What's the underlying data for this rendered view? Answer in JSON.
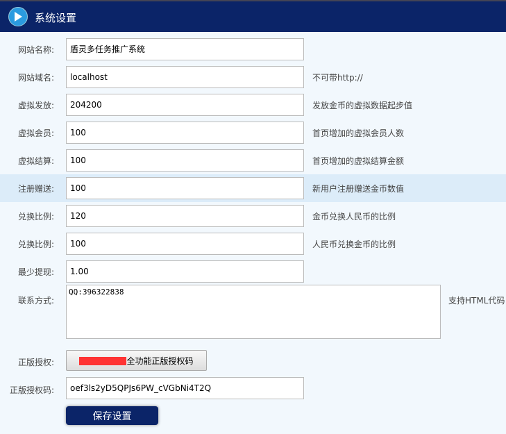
{
  "header": {
    "title": "系统设置",
    "logo_icon": "app-logo-icon"
  },
  "fields": [
    {
      "label": "网站名称:",
      "value": "盾灵多任务推广系统",
      "hint": ""
    },
    {
      "label": "网站域名:",
      "value": "localhost",
      "hint": "不可带http://"
    },
    {
      "label": "虚拟发放:",
      "value": "204200",
      "hint": "发放金币的虚拟数据起步值"
    },
    {
      "label": "虚拟会员:",
      "value": "100",
      "hint": "首页增加的虚拟会员人数"
    },
    {
      "label": "虚拟结算:",
      "value": "100",
      "hint": "首页增加的虚拟结算金额"
    },
    {
      "label": "注册赠送:",
      "value": "100",
      "hint": "新用户注册赠送金币数值"
    },
    {
      "label": "兑换比例:",
      "value": "120",
      "hint": "金币兑换人民币的比例"
    },
    {
      "label": "兑换比例:",
      "value": "100",
      "hint": "人民币兑换金币的比例"
    },
    {
      "label": "最少提现:",
      "value": "1.00",
      "hint": ""
    }
  ],
  "contact": {
    "label": "联系方式:",
    "value": "QQ:396322838",
    "hint": "支持HTML代码"
  },
  "auth": {
    "label": "正版授权:",
    "button": "全功能正版授权码"
  },
  "auth_code": {
    "label": "正版授权码:",
    "value": "oef3ls2yD5QPJs6PW_cVGbNi4T2Q"
  },
  "save_label": "保存设置"
}
